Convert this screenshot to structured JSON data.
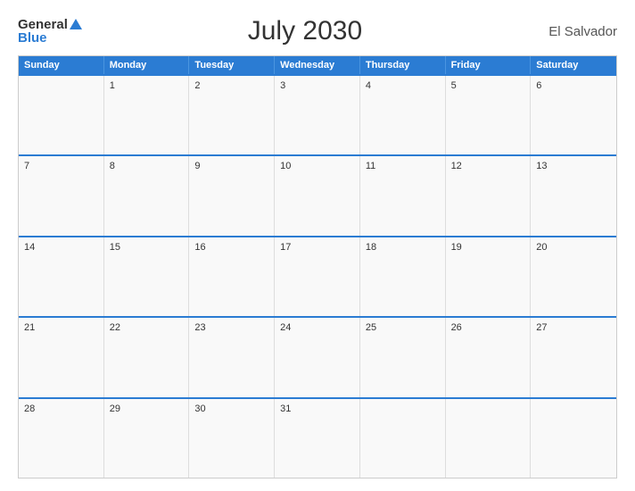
{
  "header": {
    "logo_general": "General",
    "logo_blue": "Blue",
    "title": "July 2030",
    "country": "El Salvador"
  },
  "dayHeaders": [
    "Sunday",
    "Monday",
    "Tuesday",
    "Wednesday",
    "Thursday",
    "Friday",
    "Saturday"
  ],
  "weeks": [
    [
      {
        "num": "",
        "empty": true
      },
      {
        "num": "1"
      },
      {
        "num": "2"
      },
      {
        "num": "3"
      },
      {
        "num": "4"
      },
      {
        "num": "5"
      },
      {
        "num": "6"
      }
    ],
    [
      {
        "num": "7"
      },
      {
        "num": "8"
      },
      {
        "num": "9"
      },
      {
        "num": "10"
      },
      {
        "num": "11"
      },
      {
        "num": "12"
      },
      {
        "num": "13"
      }
    ],
    [
      {
        "num": "14"
      },
      {
        "num": "15"
      },
      {
        "num": "16"
      },
      {
        "num": "17"
      },
      {
        "num": "18"
      },
      {
        "num": "19"
      },
      {
        "num": "20"
      }
    ],
    [
      {
        "num": "21"
      },
      {
        "num": "22"
      },
      {
        "num": "23"
      },
      {
        "num": "24"
      },
      {
        "num": "25"
      },
      {
        "num": "26"
      },
      {
        "num": "27"
      }
    ],
    [
      {
        "num": "28"
      },
      {
        "num": "29"
      },
      {
        "num": "30"
      },
      {
        "num": "31"
      },
      {
        "num": "",
        "empty": true
      },
      {
        "num": "",
        "empty": true
      },
      {
        "num": "",
        "empty": true
      }
    ]
  ],
  "colors": {
    "header_bg": "#2b7cd3",
    "border_accent": "#2b7cd3",
    "cell_bg": "#f9f9f9"
  }
}
